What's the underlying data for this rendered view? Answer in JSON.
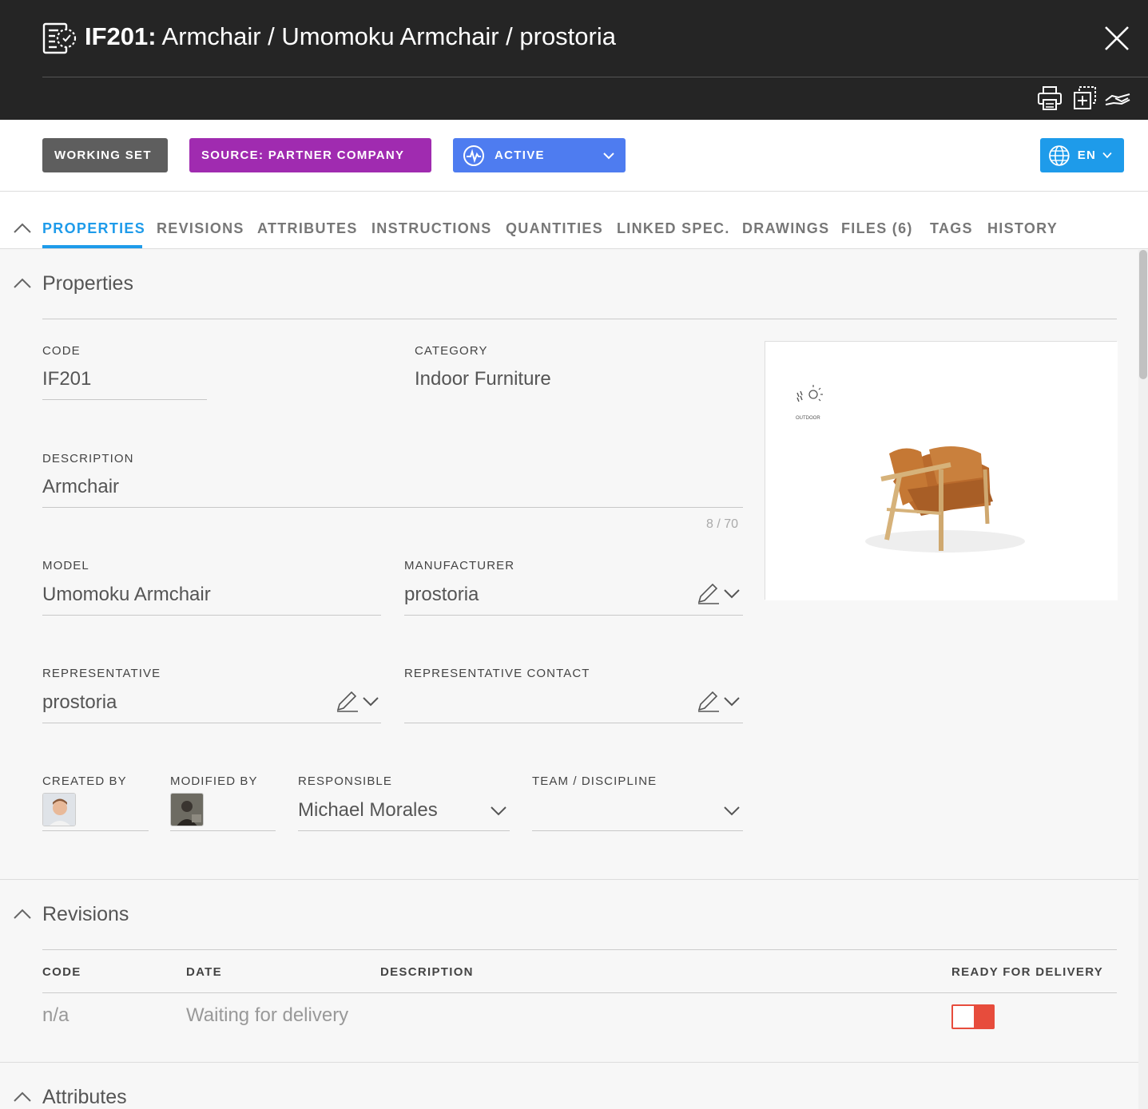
{
  "header": {
    "code": "IF201:",
    "path": " Armchair / Umomoku Armchair / prostoria"
  },
  "status": {
    "working_set": "WORKING SET",
    "source": "SOURCE: PARTNER COMPANY",
    "active": "ACTIVE",
    "language": "EN"
  },
  "tabs": [
    "PROPERTIES",
    "REVISIONS",
    "ATTRIBUTES",
    "INSTRUCTIONS",
    "QUANTITIES",
    "LINKED SPEC.",
    "DRAWINGS",
    "FILES (6)",
    "TAGS",
    "HISTORY"
  ],
  "properties": {
    "title": "Properties",
    "code_label": "CODE",
    "code_value": "IF201",
    "category_label": "CATEGORY",
    "category_value": "Indoor Furniture",
    "description_label": "DESCRIPTION",
    "description_value": "Armchair",
    "description_counter": "8 / 70",
    "model_label": "MODEL",
    "model_value": "Umomoku Armchair",
    "manufacturer_label": "MANUFACTURER",
    "manufacturer_value": "prostoria",
    "representative_label": "REPRESENTATIVE",
    "representative_value": "prostoria",
    "rep_contact_label": "REPRESENTATIVE CONTACT",
    "rep_contact_value": "",
    "created_by_label": "CREATED BY",
    "modified_by_label": "MODIFIED BY",
    "responsible_label": "RESPONSIBLE",
    "responsible_value": "Michael Morales",
    "team_label": "TEAM / DISCIPLINE",
    "team_value": "",
    "image_badge": "OUTDOOR"
  },
  "revisions": {
    "title": "Revisions",
    "columns": [
      "CODE",
      "DATE",
      "DESCRIPTION",
      "READY FOR DELIVERY"
    ],
    "rows": [
      {
        "code": "n/a",
        "date": "Waiting for delivery",
        "description": "",
        "ready": false
      }
    ]
  },
  "attributes": {
    "title": "Attributes"
  },
  "colors": {
    "accent": "#1e9bea",
    "source_chip": "#a02bb0",
    "active_chip": "#4e7cf0",
    "toggle_off": "#e74c3c"
  }
}
